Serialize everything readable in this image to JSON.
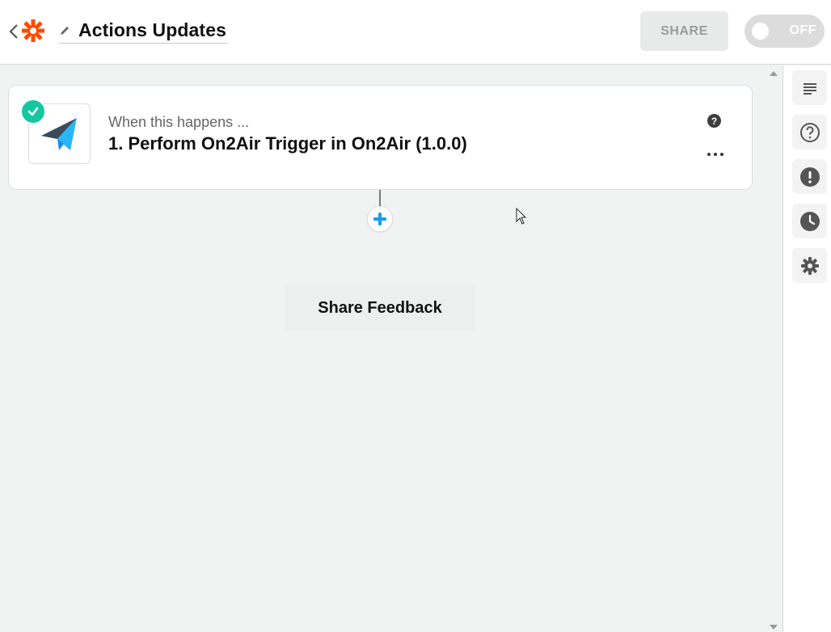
{
  "header": {
    "title": "Actions Updates",
    "share_label": "SHARE",
    "toggle_label": "OFF",
    "icons": {
      "back": "chevron-left-icon",
      "logo": "zapier-asterisk-logo",
      "edit": "pencil-icon"
    },
    "colors": {
      "logo": "#ff4a00"
    }
  },
  "step": {
    "subtitle": "When this happens ...",
    "title": "1. Perform On2Air Trigger in On2Air (1.0.0)",
    "help_glyph": "?",
    "status": "complete",
    "app_icon": "paper-plane-icon",
    "colors": {
      "check": "#13c7a1",
      "plane_dark": "#3d4a59",
      "plane_light": "#29b6f6"
    }
  },
  "canvas": {
    "add_step_icon": "plus-icon",
    "feedback_label": "Share Feedback",
    "add_color": "#1a9cf0"
  },
  "sidebar": {
    "items": [
      {
        "icon": "notes-icon"
      },
      {
        "icon": "help-circle-icon"
      },
      {
        "icon": "alert-icon"
      },
      {
        "icon": "clock-icon"
      },
      {
        "icon": "gear-icon"
      }
    ]
  }
}
